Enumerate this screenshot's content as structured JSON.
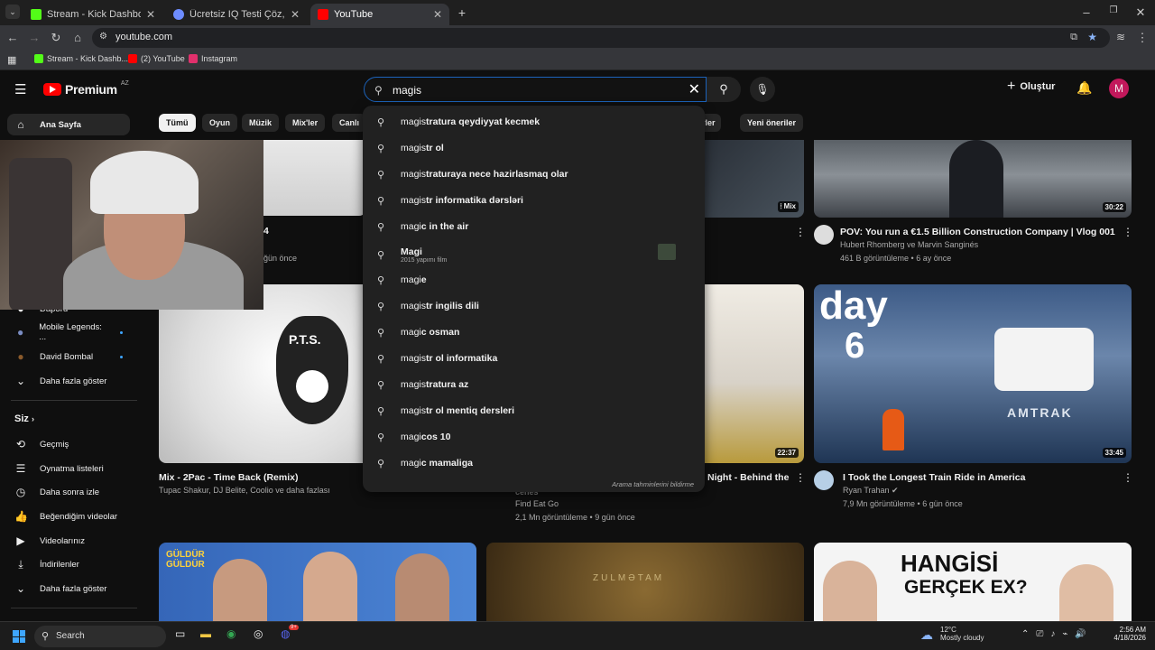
{
  "browser": {
    "tabs": [
      {
        "label": "Stream - Kick Dashboard",
        "color": "#53fc18",
        "active": false
      },
      {
        "label": "Ücretsiz IQ Testi Çöz, IQ Seviyen",
        "color": "#6d8cff",
        "active": false
      },
      {
        "label": "YouTube",
        "color": "#ff0000",
        "active": true
      }
    ],
    "new_tab": "+",
    "url": "youtube.com",
    "bookmarks": [
      {
        "label": "Stream - Kick Dashb...",
        "color": "#53fc18"
      },
      {
        "label": "(2) YouTube",
        "color": "#ff0000"
      },
      {
        "label": "Instagram",
        "color": "#e1306c"
      }
    ]
  },
  "header": {
    "logo_text": "Premium",
    "region": "AZ",
    "search_query": "magis",
    "create_label": "Oluştur",
    "avatar_letter": "M"
  },
  "chips": [
    "Tümü",
    "Oyun",
    "Müzik",
    "Mix'ler",
    "Canlı",
    "önerler",
    "Yeni öneriler"
  ],
  "sidebar": {
    "home": "Ana Sayfa",
    "subs": [
      {
        "label": "Mobile Legends: ...",
        "dot": true
      },
      {
        "label": "David Bombal",
        "dot": true
      }
    ],
    "partial_item": "Daporu",
    "show_more": "Daha fazla göster",
    "you_heading": "Siz",
    "you_items": [
      "Geçmiş",
      "Oynatma listeleri",
      "Daha sonra izle",
      "Beğendiğim videolar",
      "Videolarınız",
      "İndirilenler",
      "Daha fazla göster"
    ]
  },
  "suggestions": [
    {
      "prefix": "magis",
      "rest": "tratura qeydiyyat kecmek"
    },
    {
      "prefix": "magis",
      "rest": "tr ol"
    },
    {
      "prefix": "magis",
      "rest": "traturaya nece hazirlasmaq olar"
    },
    {
      "prefix": "magis",
      "rest": "tr informatika dərsləri"
    },
    {
      "prefix": "magi",
      "rest": "c in the air"
    },
    {
      "prefix": "Magi",
      "rest": "",
      "sub": "2015 yapımı film",
      "thumb": true
    },
    {
      "prefix": "magi",
      "rest": "e"
    },
    {
      "prefix": "magis",
      "rest": "tr ingilis dili"
    },
    {
      "prefix": "magi",
      "rest": "c osman"
    },
    {
      "prefix": "magis",
      "rest": "tr ol informatika"
    },
    {
      "prefix": "magis",
      "rest": "tratura az"
    },
    {
      "prefix": "magis",
      "rest": "tr ol mentiq dersleri"
    },
    {
      "prefix": "magi",
      "rest": "cos 10"
    },
    {
      "prefix": "magi",
      "rest": "c mamaliga"
    }
  ],
  "report_label": "Arama tahminlerini bildirme",
  "videos": {
    "top_partial_meta": "ğün önce",
    "top_partial_title": "4",
    "mix_badge": "Mix",
    "pov": {
      "title": "POV: You run a €1.5 Billion Construction Company | Vlog 001",
      "channel": "Hubert Rhomberg ve Marvin Sanginés",
      "meta": "461 B görüntüleme • 6 ay önce",
      "duration": "30:22"
    },
    "mix2pac": {
      "title": "Mix - 2Pac - Time Back (Remix)",
      "channel": "Tupac Shakur, DJ Belite, Coolio ve daha fazlası",
      "logo": "P.T.S."
    },
    "food": {
      "title": "Night - Behind the",
      "title_cut": "cenes",
      "channel": "Find Eat Go",
      "meta": "2,1 Mn görüntüleme • 9 gün önce",
      "duration": "22:37"
    },
    "train": {
      "title": "I Took the Longest Train Ride in America",
      "channel": "Ryan Trahan",
      "meta": "7,9 Mn görüntüleme • 6 gün önce",
      "duration": "33:45",
      "thumb_big": "day",
      "thumb_num": "6",
      "thumb_brand": "AMTRAK"
    },
    "bottom": {
      "guldur": "GÜLDÜR GÜLDÜR",
      "zulmet": "ZULMƏTAM",
      "hangisi1": "HANGİSİ",
      "hangisi2": "GERÇEK EX?"
    }
  },
  "taskbar": {
    "search": "Search",
    "weather_temp": "12°C",
    "weather_desc": "Mostly cloudy",
    "time": "2:56 AM",
    "date": "4/18/2026",
    "discord_badge": "9+"
  }
}
